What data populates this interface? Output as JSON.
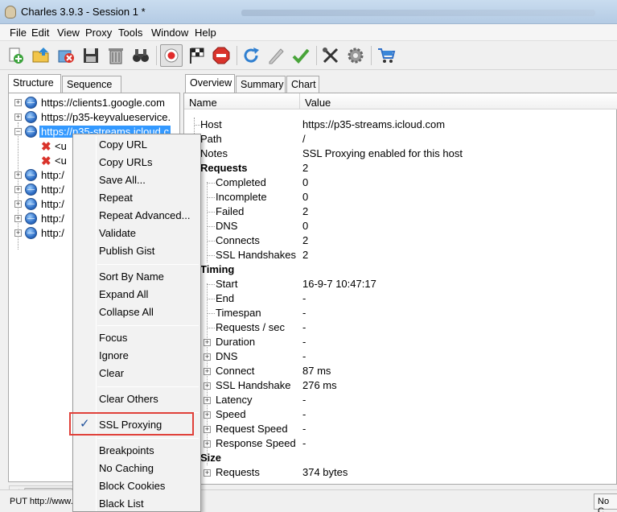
{
  "window": {
    "title": "Charles 3.9.3 - Session 1 *"
  },
  "menubar": [
    "File",
    "Edit",
    "View",
    "Proxy",
    "Tools",
    "Window",
    "Help"
  ],
  "toolbar": {
    "buttons": [
      "new-session-icon",
      "open-session-icon",
      "close-session-icon",
      "save-icon",
      "trash-icon",
      "find-icon",
      "record-icon",
      "throttle-flag-icon",
      "stop-breakpoints-icon",
      "refresh-icon",
      "edit-pencil-icon",
      "validate-check-icon",
      "tools-icon",
      "settings-gear-icon",
      "shopping-cart-icon"
    ]
  },
  "left_tabs": [
    "Structure",
    "Sequence"
  ],
  "tree": {
    "items": [
      {
        "label": "https://clients1.google.com"
      },
      {
        "label": "https://p35-keyvalueservice."
      },
      {
        "label": "https://p35-streams.icloud.c"
      },
      {
        "label": "<u"
      },
      {
        "label": "<u"
      },
      {
        "label": "http:/"
      },
      {
        "label": "http:/"
      },
      {
        "label": "http:/"
      },
      {
        "label": "http:/"
      },
      {
        "label": "http:/"
      }
    ]
  },
  "context_menu": {
    "items": [
      "Copy URL",
      "Copy URLs",
      "Save All...",
      "Repeat",
      "Repeat Advanced...",
      "Validate",
      "Publish Gist",
      "Sort By Name",
      "Expand All",
      "Collapse All",
      "Focus",
      "Ignore",
      "Clear",
      "Clear Others",
      "SSL Proxying",
      "Breakpoints",
      "No Caching",
      "Block Cookies",
      "Black List"
    ],
    "checked_item": "SSL Proxying",
    "check_glyph": "✓"
  },
  "right_tabs": [
    "Overview",
    "Summary",
    "Chart"
  ],
  "table": {
    "headers": {
      "name": "Name",
      "value": "Value"
    },
    "rows": [
      {
        "name": "Host",
        "value": "https://p35-streams.icloud.com"
      },
      {
        "name": "Path",
        "value": "/"
      },
      {
        "name": "Notes",
        "value": "SSL Proxying enabled for this host"
      },
      {
        "name": "Requests",
        "value": "2"
      },
      {
        "name": "Completed",
        "value": "0"
      },
      {
        "name": "Incomplete",
        "value": "0"
      },
      {
        "name": "Failed",
        "value": "2"
      },
      {
        "name": "DNS",
        "value": "0"
      },
      {
        "name": "Connects",
        "value": "2"
      },
      {
        "name": "SSL Handshakes",
        "value": "2"
      },
      {
        "name": "Timing",
        "value": ""
      },
      {
        "name": "Start",
        "value": "16-9-7 10:47:17"
      },
      {
        "name": "End",
        "value": "-"
      },
      {
        "name": "Timespan",
        "value": "-"
      },
      {
        "name": "Requests / sec",
        "value": "-"
      },
      {
        "name": "Duration",
        "value": "-"
      },
      {
        "name": "DNS",
        "value": "-"
      },
      {
        "name": "Connect",
        "value": "87 ms"
      },
      {
        "name": "SSL Handshake",
        "value": "276 ms"
      },
      {
        "name": "Latency",
        "value": "-"
      },
      {
        "name": "Speed",
        "value": "-"
      },
      {
        "name": "Request Speed",
        "value": "-"
      },
      {
        "name": "Response Speed",
        "value": "-"
      },
      {
        "name": "Size",
        "value": ""
      },
      {
        "name": "Requests",
        "value": "374 bytes"
      }
    ]
  },
  "status": {
    "text": "PUT http://www.j",
    "right": "No C"
  },
  "colors": {
    "selection": "#3399ff",
    "highlight_border": "#e0413a"
  }
}
